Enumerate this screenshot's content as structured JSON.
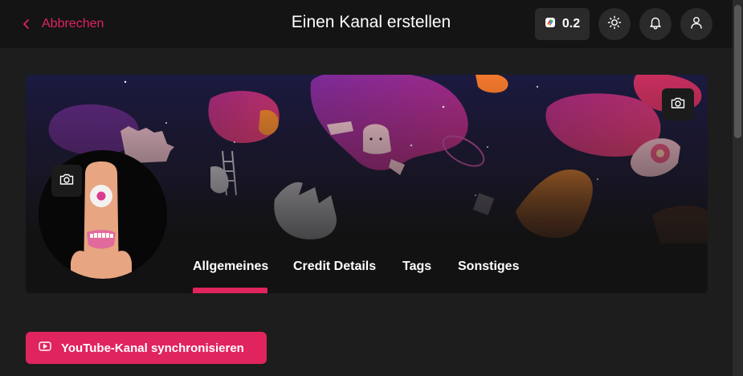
{
  "header": {
    "back_label": "Abbrechen",
    "title": "Einen Kanal erstellen",
    "credits": "0.2"
  },
  "tabs": [
    {
      "label": "Allgemeines",
      "active": true
    },
    {
      "label": "Credit Details",
      "active": false
    },
    {
      "label": "Tags",
      "active": false
    },
    {
      "label": "Sonstiges",
      "active": false
    }
  ],
  "actions": {
    "youtube_sync_label": "YouTube-Kanal synchronisieren"
  },
  "icons": {
    "back": "chevron-left-icon",
    "credits": "credit-logo-icon",
    "theme": "sun-icon",
    "notifications": "bell-icon",
    "account": "user-icon",
    "banner_upload": "camera-icon",
    "avatar_upload": "camera-icon",
    "youtube": "youtube-icon"
  },
  "colors": {
    "accent": "#e0245e",
    "background": "#1d1d1d",
    "topbar": "#141414",
    "surface": "#2a2a2a"
  }
}
